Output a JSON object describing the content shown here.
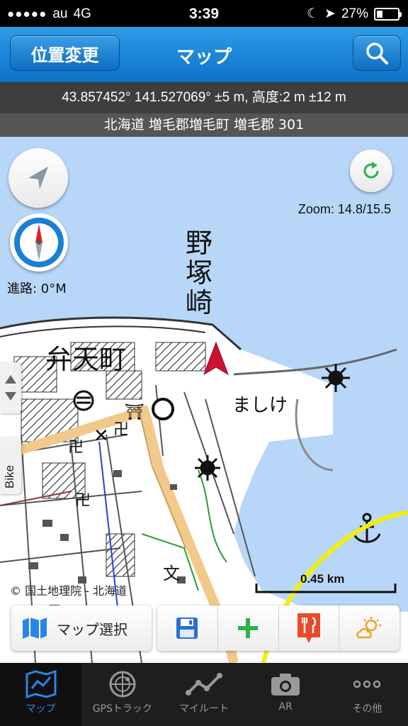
{
  "status": {
    "carrier": "au",
    "network": "4G",
    "time": "3:39",
    "battery": "27%"
  },
  "navbar": {
    "left_button": "位置変更",
    "title": "マップ"
  },
  "info": {
    "coordinates": "43.857452° 141.527069° ±5 m, 高度:2 m ±12 m",
    "address": "北海道 増毛郡増毛町 増毛郡 301"
  },
  "map": {
    "zoom": "Zoom: 14.8/15.5",
    "heading": "進路: 0°M",
    "side_tab": "Bike",
    "credit": "© 国土地理院 - 北海道",
    "scale": "0.45 km",
    "labels": {
      "place1": "野塚崎",
      "place2": "弁天町",
      "place3": "ましけ"
    }
  },
  "toolbar": {
    "map_select": "マップ選択"
  },
  "tabs": [
    {
      "label": "マップ",
      "icon": "map-icon",
      "active": true
    },
    {
      "label": "GPSトラック",
      "icon": "radar-icon",
      "active": false
    },
    {
      "label": "マイルート",
      "icon": "route-icon",
      "active": false
    },
    {
      "label": "AR",
      "icon": "camera-icon",
      "active": false
    },
    {
      "label": "その他",
      "icon": "more-icon",
      "active": false
    }
  ],
  "colors": {
    "nav_blue": "#1a82d8",
    "tab_active": "#2a86e6",
    "sea": "#b8d6f8",
    "heading_marker": "#d01030",
    "scale_circle": "#f5f000"
  }
}
